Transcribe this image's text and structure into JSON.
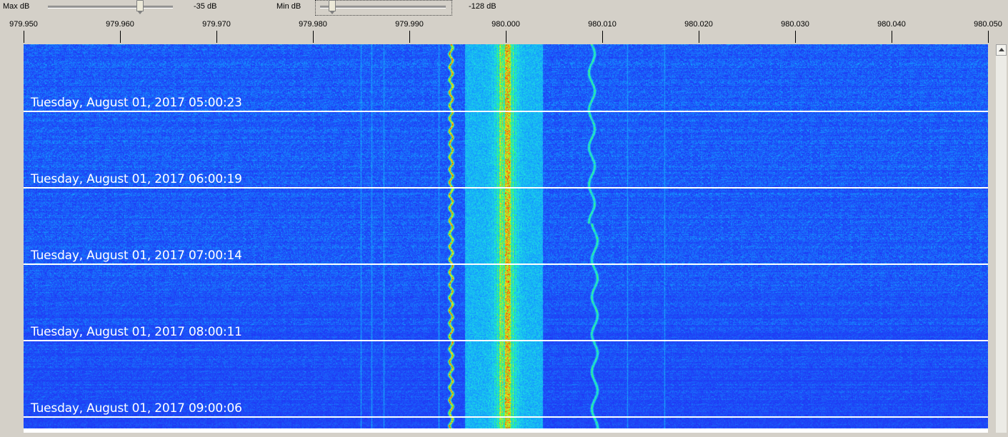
{
  "controls": {
    "max_db": {
      "label": "Max dB",
      "value_text": "-35 dB",
      "level": 0.73
    },
    "min_db": {
      "label": "Min dB",
      "value_text": "-128 dB",
      "level": 0.09
    }
  },
  "frequency_axis": {
    "min": 979.95,
    "max": 980.05,
    "ticks": [
      "979.950",
      "979.960",
      "979.970",
      "979.980",
      "979.990",
      "980.000",
      "980.010",
      "980.020",
      "980.030",
      "980.040",
      "980.050"
    ]
  },
  "timestamps": [
    "Tuesday, August 01, 2017 05:00:23",
    "Tuesday, August 01, 2017 06:00:19",
    "Tuesday, August 01, 2017 07:00:14",
    "Tuesday, August 01, 2017 08:00:11",
    "Tuesday, August 01, 2017 09:00:06"
  ],
  "colors": {
    "background_blue": "#2a3cf0",
    "signal_cyan": "#18c8ff",
    "signal_green": "#30ff40",
    "signal_yellow": "#ffe020",
    "signal_red": "#ff2000",
    "timestamp_line": "#ffffff"
  },
  "icons": {
    "scroll_up": "triangle-up-icon"
  }
}
